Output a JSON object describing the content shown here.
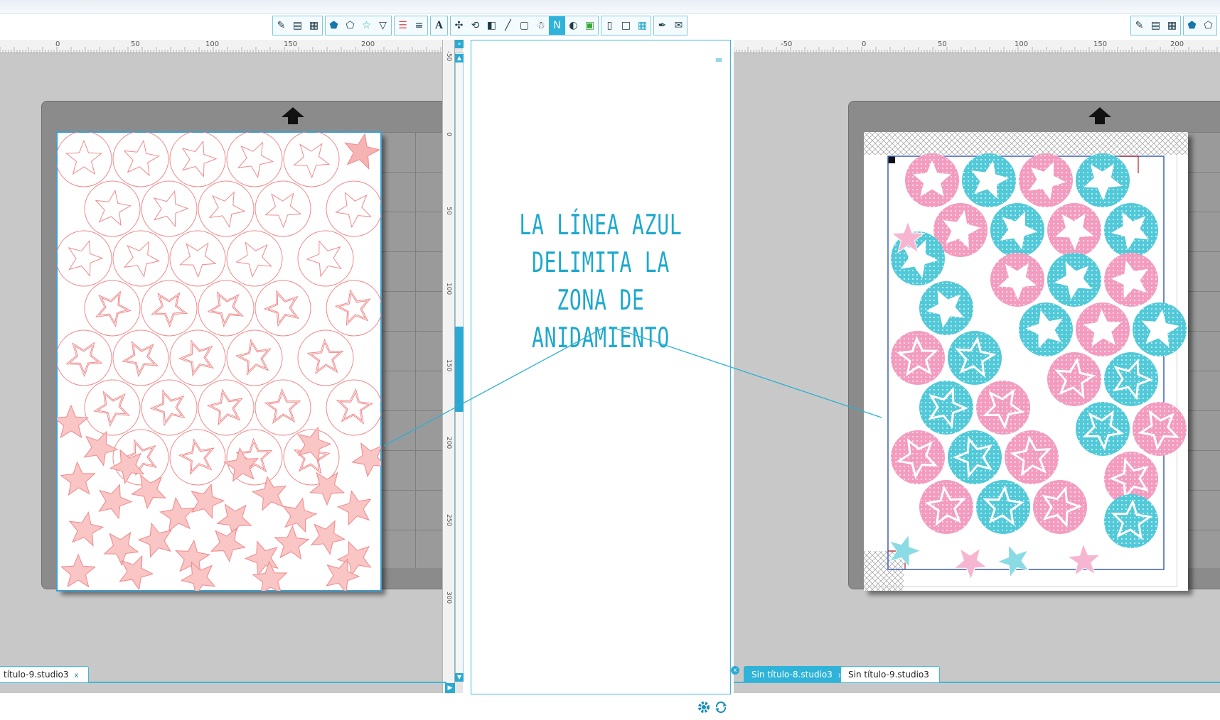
{
  "colors": {
    "accent": "#2fb3d8",
    "cut_line": "#f0898a",
    "nesting_line": "#3a5fbf",
    "pink": "#f39cc0",
    "cyan": "#52c9d8",
    "annotation": "#1fa8cc"
  },
  "toolbar": {
    "icons": [
      "eraser-icon",
      "panel-icon",
      "dotted-fill-icon",
      "pentagon-fill-icon",
      "pentagon-outline-icon",
      "star-outline-icon",
      "shape-edit-icon",
      "line-color-icon",
      "line-style-icon",
      "text-icon",
      "align-icon",
      "rotate-icon",
      "scale-icon",
      "knife-icon",
      "replicate-icon",
      "nesting-icon",
      "nest-active-icon",
      "offset-icon",
      "trace-icon",
      "page-icon",
      "crop-icon",
      "grid-icon",
      "pen-icon",
      "send-icon"
    ],
    "active_icon": "nest-active-icon"
  },
  "left_ruler": {
    "labels": [
      "0",
      "50",
      "100",
      "150",
      "200"
    ]
  },
  "right_ruler": {
    "labels": [
      "-50",
      "0",
      "50",
      "100",
      "150",
      "200"
    ]
  },
  "vertical_ruler": {
    "labels": [
      "-50",
      "0",
      "50",
      "100",
      "150",
      "200",
      "250",
      "300"
    ]
  },
  "annotation": {
    "line1": "LA LÍNEA AZUL",
    "line2": "DELIMITA LA ZONA DE",
    "line3": "ANIDAMIENTO"
  },
  "left_tabs": {
    "tab1": "título-9.studio3"
  },
  "right_tabs": {
    "tab1": "Sin título-8.studio3",
    "tab2": "Sin título-9.studio3"
  },
  "panel_menu": "="
}
